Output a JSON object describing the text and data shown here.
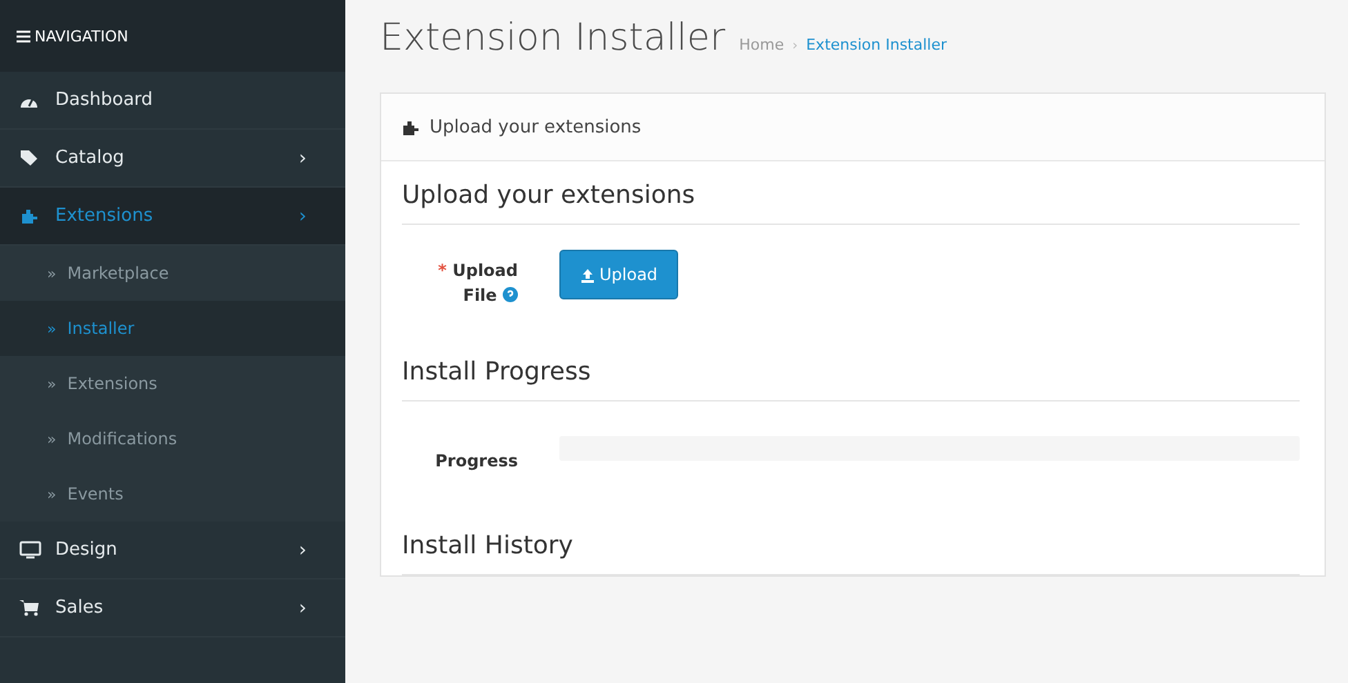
{
  "sidebar": {
    "header": "NAVIGATION",
    "items": [
      {
        "label": "Dashboard",
        "selected": false
      },
      {
        "label": "Catalog",
        "selected": false,
        "arrow": "›"
      },
      {
        "label": "Extensions",
        "selected": true,
        "arrow": "›",
        "expanded": true,
        "children": [
          {
            "bullet": "»",
            "label": "Marketplace",
            "selected": false
          },
          {
            "bullet": "»",
            "label": "Installer",
            "selected": true
          },
          {
            "bullet": "»",
            "label": "Extensions",
            "selected": false
          },
          {
            "bullet": "»",
            "label": "Modifications",
            "selected": false
          },
          {
            "bullet": "»",
            "label": "Events",
            "selected": false
          }
        ]
      },
      {
        "label": "Design",
        "selected": false,
        "arrow": "›"
      },
      {
        "label": "Sales",
        "selected": false,
        "arrow": "›"
      }
    ]
  },
  "page": {
    "title": "Extension Installer",
    "breadcrumb": [
      "Home",
      "Extension Installer"
    ],
    "separator": "›"
  },
  "panel": {
    "heading": "Upload your extensions",
    "sections": [
      {
        "kind": "upload",
        "title": "Upload your extensions",
        "required_mark": "*",
        "label": "Upload File",
        "button": "Upload"
      },
      {
        "kind": "progress",
        "title": "Install Progress",
        "label": "Progress",
        "level": 0
      },
      {
        "kind": "history",
        "title": "Install History"
      }
    ]
  }
}
